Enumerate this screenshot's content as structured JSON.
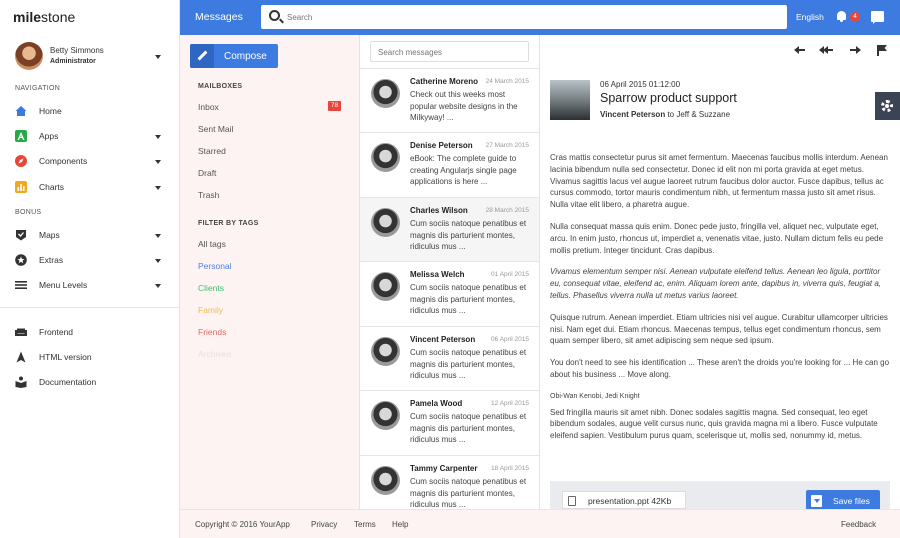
{
  "brand": {
    "prefix": "mile",
    "suffix": "stone"
  },
  "user": {
    "name": "Betty Simmons",
    "role": "Administrator"
  },
  "sidebar": {
    "section_navigation": "NAVIGATION",
    "section_bonus": "BONUS",
    "nav": [
      {
        "label": "Home",
        "icon": "home-icon",
        "color": "#3d7be0"
      },
      {
        "label": "Apps",
        "icon": "apps-icon",
        "color": "#29a84a"
      },
      {
        "label": "Components",
        "icon": "compass-icon",
        "color": "#e8463a"
      },
      {
        "label": "Charts",
        "icon": "chart-icon",
        "color": "#f2a91f"
      }
    ],
    "bonus": [
      {
        "label": "Maps",
        "icon": "map-icon"
      },
      {
        "label": "Extras",
        "icon": "star-icon"
      },
      {
        "label": "Menu Levels",
        "icon": "menu-icon"
      }
    ],
    "bottom": [
      {
        "label": "Frontend",
        "icon": "sofa-icon"
      },
      {
        "label": "HTML version",
        "icon": "navigate-icon"
      },
      {
        "label": "Documentation",
        "icon": "book-icon"
      }
    ]
  },
  "topbar": {
    "title": "Messages",
    "search_placeholder": "Search",
    "language": "English",
    "notifications": "4"
  },
  "mailpanel": {
    "compose": "Compose",
    "mailboxes_head": "MAILBOXES",
    "mailboxes": [
      "Inbox",
      "Sent Mail",
      "Starred",
      "Draft",
      "Trash"
    ],
    "inbox_count": "78",
    "tags_head": "FILTER BY TAGS",
    "tags": [
      {
        "label": "All tags",
        "color": "#555555"
      },
      {
        "label": "Personal",
        "color": "#4f7fe0"
      },
      {
        "label": "Clients",
        "color": "#3fbf6f"
      },
      {
        "label": "Family",
        "color": "#f2b94a"
      },
      {
        "label": "Friends",
        "color": "#e8665c"
      },
      {
        "label": "Archived",
        "color": "#e8e0df"
      }
    ]
  },
  "msglist": {
    "search_placeholder": "Search messages",
    "messages": [
      {
        "from": "Catherine Moreno",
        "date": "24 March 2015",
        "preview": "Check out this weeks most popular website designs in the Milkyway! ..."
      },
      {
        "from": "Denise Peterson",
        "date": "27 March 2015",
        "preview": "eBook: The complete guide to creating Angularjs single page applications is here ..."
      },
      {
        "from": "Charles Wilson",
        "date": "28 March 2015",
        "preview": "Cum sociis natoque penatibus et magnis dis parturient montes, ridiculus mus ..."
      },
      {
        "from": "Melissa Welch",
        "date": "01 April 2015",
        "preview": "Cum sociis natoque penatibus et magnis dis parturient montes, ridiculus mus ..."
      },
      {
        "from": "Vincent Peterson",
        "date": "06 April 2015",
        "preview": "Cum sociis natoque penatibus et magnis dis parturient montes, ridiculus mus ..."
      },
      {
        "from": "Pamela Wood",
        "date": "12 April 2015",
        "preview": "Cum sociis natoque penatibus et magnis dis parturient montes, ridiculus mus ..."
      },
      {
        "from": "Tammy Carpenter",
        "date": "18 April 2015",
        "preview": "Cum sociis natoque penatibus et magnis dis parturient montes, ridiculus mus ..."
      }
    ]
  },
  "reader": {
    "date": "06 April 2015 01:12:00",
    "subject": "Sparrow product support",
    "from_name": "Vincent Peterson",
    "to_text": "to Jeff & Suzzane",
    "paragraphs": [
      "Cras mattis consectetur purus sit amet fermentum. Maecenas faucibus mollis interdum. Aenean lacinia bibendum nulla sed consectetur. Donec id elit non mi porta gravida at eget metus. Vivamus sagittis lacus vel augue laoreet rutrum faucibus dolor auctor. Fusce dapibus, tellus ac cursus commodo, tortor mauris condimentum nibh, ut fermentum massa justo sit amet risus. Nulla vitae elit libero, a pharetra augue.",
      "Nulla consequat massa quis enim. Donec pede justo, fringilla vel, aliquet nec, vulputate eget, arcu. In enim justo, rhoncus ut, imperdiet a, venenatis vitae, justo. Nullam dictum felis eu pede mollis pretium. Integer tincidunt. Cras dapibus.",
      "Vivamus elementum semper nisi. Aenean vulputate eleifend tellus. Aenean leo ligula, porttitor eu, consequat vitae, eleifend ac, enim. Aliquam lorem ante, dapibus in, viverra quis, feugiat a, tellus. Phasellus viverra nulla ut metus varius laoreet.",
      "Quisque rutrum. Aenean imperdiet. Etiam ultricies nisi vel augue. Curabitur ullamcorper ultricies nisi. Nam eget dui. Etiam rhoncus. Maecenas tempus, tellus eget condimentum rhoncus, sem quam semper libero, sit amet adipiscing sem neque sed ipsum.",
      "You don't need to see his identification ... These aren't the droids you're looking for ... He can go about his business ... Move along."
    ],
    "signature": "Obi-Wan Kenobi, Jedi Knight",
    "closing": "Sed fringilla mauris sit amet nibh. Donec sodales sagittis magna. Sed consequat, leo eget bibendum sodales, augue velit cursus nunc, quis gravida magna mi a libero. Fusce vulputate eleifend sapien. Vestibulum purus quam, scelerisque ut, mollis sed, nonummy id, metus.",
    "attachment": "presentation.ppt 42Kb",
    "save_label": "Save files"
  },
  "footer": {
    "copyright": "Copyright © 2016 YourApp",
    "links": [
      "Privacy",
      "Terms",
      "Help"
    ],
    "feedback": "Feedback"
  }
}
